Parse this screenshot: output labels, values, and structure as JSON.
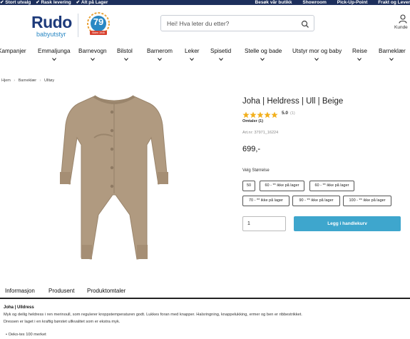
{
  "topbar": {
    "left_items": [
      "Stort utvalg",
      "Rask levering",
      "Alt på Lager"
    ],
    "right_items": [
      "Besøk vår butikk",
      "Showroom",
      "Pick-Up-Point",
      "Frakt og Lever"
    ]
  },
  "header": {
    "logo_text": "Rudo",
    "logo_sub": "babyutstyr",
    "badge_number": "79",
    "badge_caption": "Siden 1946",
    "search_placeholder": "Hei! Hva leter du etter?",
    "customer_label": "Kunde"
  },
  "nav": {
    "items": [
      {
        "label": "Kampanjer",
        "chevron": false
      },
      {
        "label": "Emmaljunga",
        "chevron": true
      },
      {
        "label": "Barnevogn",
        "chevron": true
      },
      {
        "label": "Bilstol",
        "chevron": true
      },
      {
        "label": "Barnerom",
        "chevron": true
      },
      {
        "label": "Leker",
        "chevron": true
      },
      {
        "label": "Spisetid",
        "chevron": true
      },
      {
        "label": "Stelle og bade",
        "chevron": true
      },
      {
        "label": "Utstyr mor og baby",
        "chevron": true
      },
      {
        "label": "Reise",
        "chevron": true
      },
      {
        "label": "Barneklær",
        "chevron": true
      }
    ]
  },
  "breadcrumb": [
    "Hjem",
    "Barneklær",
    "Ulltøy"
  ],
  "product": {
    "title": "Joha | Heldress | Ull | Beige",
    "rating": "5.0",
    "rating_stars": 5,
    "rating_count": "(1)",
    "reviews_label": "Omtaler (1)",
    "article_number": "Art.nr: 37971_16224",
    "price": "699,-",
    "size_label": "Velg Størrelse",
    "sizes": [
      "50",
      "60 - ** ikke på lager",
      "60 - ** ikke på lager",
      "70 - ** ikke på lager",
      "90 - ** ikke på lager",
      "100 - ** ikke på lager"
    ],
    "quantity": "1",
    "add_to_cart": "Legg i handlekurv"
  },
  "tabs": [
    "Informasjon",
    "Produsent",
    "Produktomtaler"
  ],
  "description": {
    "title": "Joha | Ulldress",
    "lines": [
      "Myk og deilig heldress i ren merinoull, som regulerer kroppstemperaturen godt. Lukkes foran med knapper. Halsringning, knappelukking, ermer og ben er ribbestrikket.",
      "Dressen er laget i en kraftig børstet ullkvalitet som er ekstra myk."
    ],
    "bullets": [
      "Oeko-tex 100 merket"
    ]
  },
  "colors": {
    "topbar": "#1d2f5c",
    "brand_blue": "#1d3a7a",
    "accent_button": "#3ea6cd",
    "star": "#f2b01e",
    "garment": "#b09a80"
  }
}
